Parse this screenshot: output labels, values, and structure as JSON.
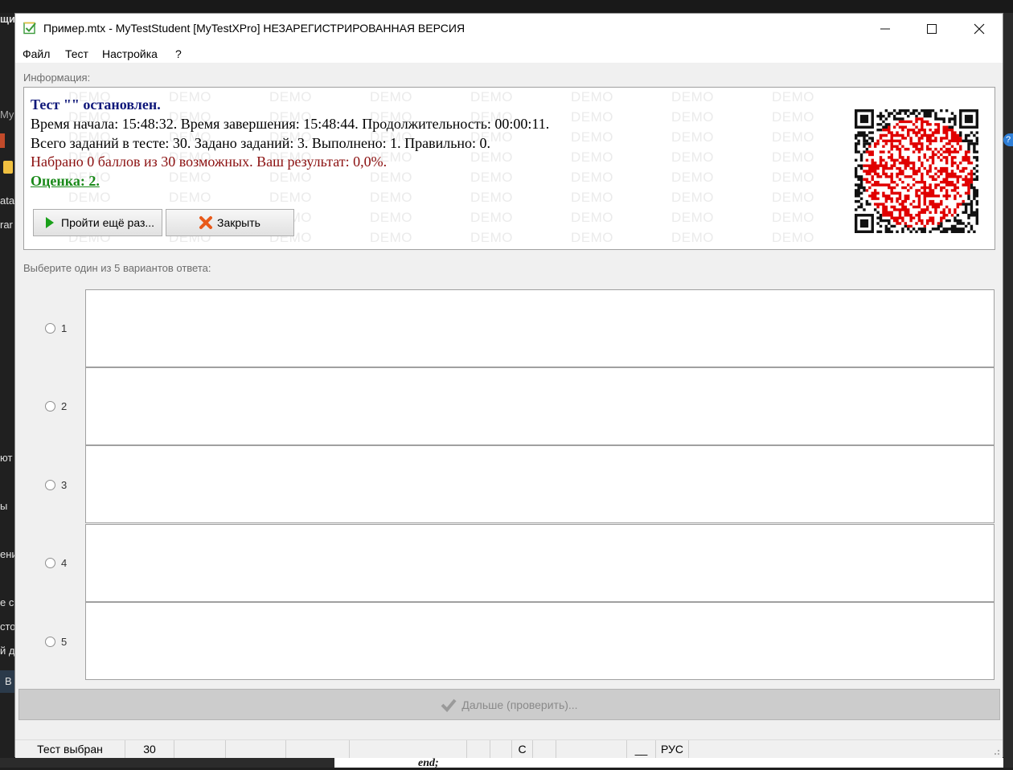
{
  "window": {
    "title": "Пример.mtx - MyTestStudent [MyTestXPro] НЕЗАРЕГИСТРИРОВАННАЯ ВЕРСИЯ",
    "minimize": "—",
    "maximize": "☐",
    "close": "✕"
  },
  "menu": [
    "Файл",
    "Тест",
    "Настройка",
    "?"
  ],
  "info": {
    "label": "Информация:",
    "line1": "Тест \"\" остановлен.",
    "line2": "Время начала: 15:48:32. Время завершения: 15:48:44. Продолжительность: 00:00:11.",
    "line3": "Всего заданий в тесте: 30. Задано заданий: 3. Выполнено: 1. Правильно: 0.",
    "line4": "Набрано 0 баллов из 30 возможных. Ваш результат: 0,0%.",
    "line5": "Оценка: 2.",
    "watermark": "DEMO",
    "retry_button": "Пройти ещё раз...",
    "close_button": "Закрыть"
  },
  "question": {
    "prompt": "Выберите один из 5 вариантов ответа:",
    "options": [
      "1",
      "2",
      "3",
      "4",
      "5"
    ]
  },
  "next_button": "Дальше (проверить)...",
  "status": {
    "test": "Тест выбран",
    "count": "30",
    "caps": "С",
    "underscore": "__",
    "lang": "РУС"
  },
  "background": {
    "fragments": [
      "щи",
      "My",
      "ata",
      "rar",
      "ют",
      "ы",
      "ени",
      "е с",
      "сто",
      "й д",
      "В"
    ],
    "end_text": "end;"
  },
  "colors": {
    "title_navy": "#10187a",
    "score_red": "#8b1010",
    "grade_green": "#1a8a1a",
    "qr_red": "#e00000"
  }
}
